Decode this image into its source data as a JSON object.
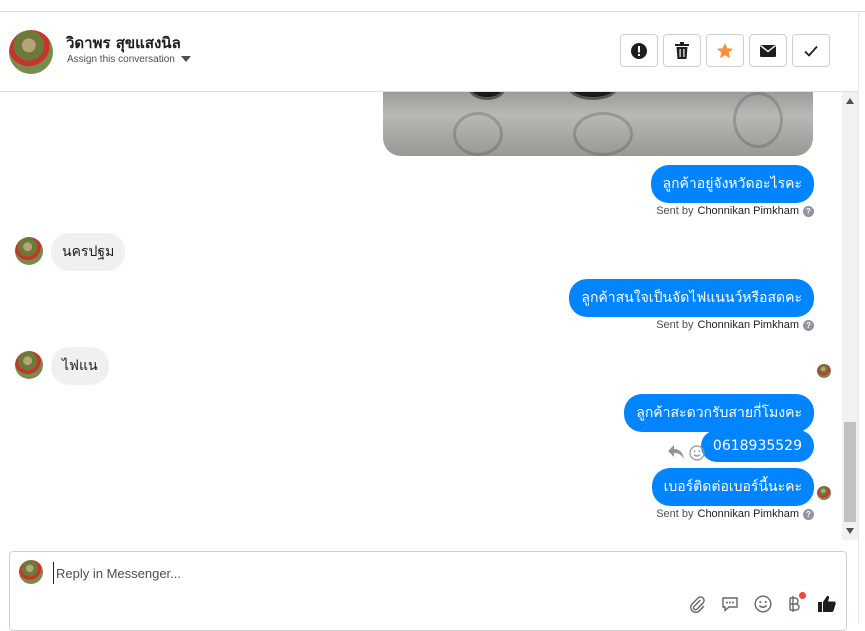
{
  "header": {
    "contact_name": "วิดาพร สุขแสงนิล",
    "assign_label": "Assign this conversation",
    "actions": [
      {
        "name": "spam",
        "icon": "exclamation-circle-icon"
      },
      {
        "name": "delete",
        "icon": "trash-icon"
      },
      {
        "name": "star",
        "icon": "star-icon",
        "color": "#f7923a"
      },
      {
        "name": "mark-unread",
        "icon": "envelope-icon"
      },
      {
        "name": "mark-done",
        "icon": "checkmark-icon"
      }
    ]
  },
  "messages": [
    {
      "type": "outgoing",
      "text": "ลูกค้าอยู่จังหวัดอะไรคะ"
    },
    {
      "type": "incoming",
      "text": "นครปฐม"
    },
    {
      "type": "outgoing",
      "text": "ลูกค้าสนใจเป็นจัดไฟแนนว์หรือสดคะ"
    },
    {
      "type": "incoming",
      "text": "ไฟแน"
    },
    {
      "type": "outgoing",
      "text": "ลูกค้าสะดวกรับสายกี่โมงคะ"
    },
    {
      "type": "outgoing",
      "text": "0618935529"
    },
    {
      "type": "outgoing",
      "text": "เบอร์ติดต่อเบอร์นี้นะคะ"
    }
  ],
  "sent_by": {
    "prefix": "Sent by",
    "agent": "Chonnikan Pimkham",
    "help": "?"
  },
  "composer": {
    "placeholder": "Reply in Messenger...",
    "icons": [
      "paperclip-icon",
      "saved-reply-icon",
      "emoji-icon",
      "baht-payment-icon",
      "thumbs-up-icon"
    ]
  },
  "colors": {
    "outgoing_bubble": "#0084ff",
    "incoming_bubble": "#f1f0f0",
    "star": "#f7923a",
    "notification_dot": "#fa3e3e"
  }
}
